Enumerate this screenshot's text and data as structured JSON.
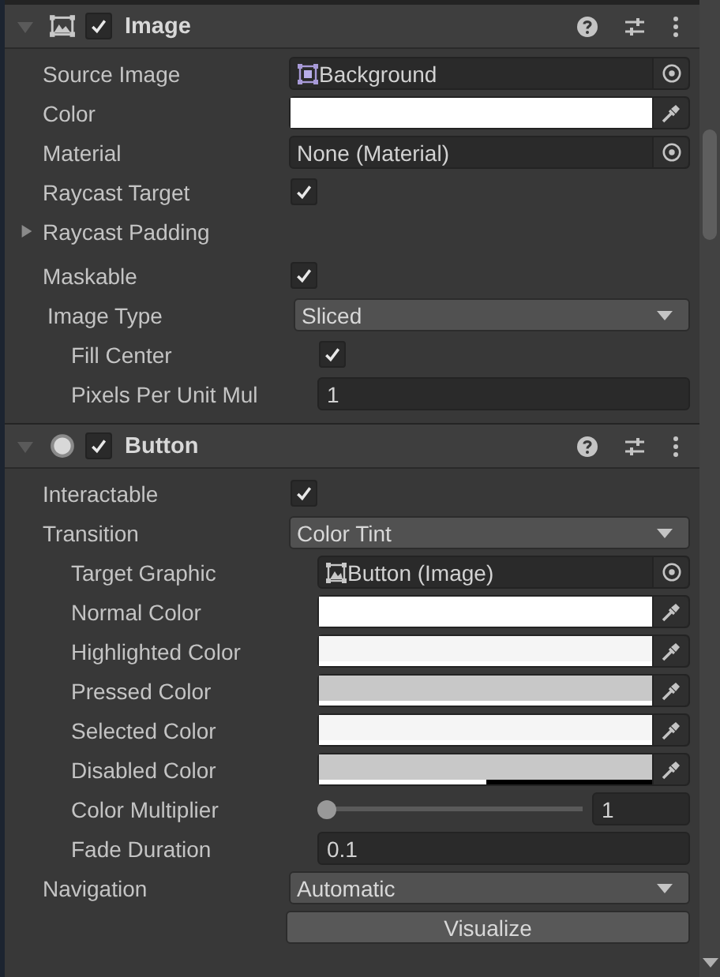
{
  "components": [
    {
      "title": "Image",
      "kind": "image",
      "enabled": true,
      "expanded": true,
      "rows": [
        {
          "kind": "sprite_object",
          "label": "Source Image",
          "value": "Background"
        },
        {
          "kind": "color",
          "label": "Color",
          "color": "#ffffff",
          "level": 1
        },
        {
          "kind": "object",
          "label": "Material",
          "value": "None (Material)"
        },
        {
          "kind": "check",
          "label": "Raycast Target",
          "checked": true
        },
        {
          "kind": "foldout",
          "label": "Raycast Padding",
          "expanded": false
        },
        {
          "kind": "check",
          "label": "Maskable",
          "checked": true
        },
        {
          "kind": "dropdown",
          "label": "Image Type",
          "value": "Sliced",
          "children": [
            {
              "kind": "check",
              "label": "Fill Center",
              "checked": true
            },
            {
              "kind": "number",
              "label": "Pixels Per Unit Mul",
              "value": "1"
            }
          ]
        }
      ]
    },
    {
      "title": "Button",
      "kind": "button",
      "enabled": true,
      "expanded": true,
      "rows": [
        {
          "kind": "check",
          "label": "Interactable",
          "checked": true
        },
        {
          "kind": "dropdown",
          "label": "Transition",
          "value": "Color Tint",
          "children": [
            {
              "kind": "image_object",
              "label": "Target Graphic",
              "value": "Button (Image)"
            },
            {
              "kind": "color",
              "label": "Normal Color",
              "color": "#ffffff",
              "level": 1
            },
            {
              "kind": "color",
              "label": "Highlighted Color",
              "color": "#f5f5f5",
              "level": 1
            },
            {
              "kind": "color",
              "label": "Pressed Color",
              "color": "#c8c8c8",
              "level": 1
            },
            {
              "kind": "color",
              "label": "Selected Color",
              "color": "#f5f5f5",
              "level": 1
            },
            {
              "kind": "color",
              "label": "Disabled Color",
              "color": "#c8c8c8",
              "level": 0.5
            },
            {
              "kind": "slider",
              "label": "Color Multiplier",
              "level": 0,
              "value": "1"
            },
            {
              "kind": "number",
              "label": "Fade Duration",
              "value": "0.1"
            }
          ]
        },
        {
          "kind": "dropdown",
          "label": "Navigation",
          "value": "Automatic"
        },
        {
          "kind": "button",
          "label": "Visualize"
        }
      ]
    }
  ]
}
